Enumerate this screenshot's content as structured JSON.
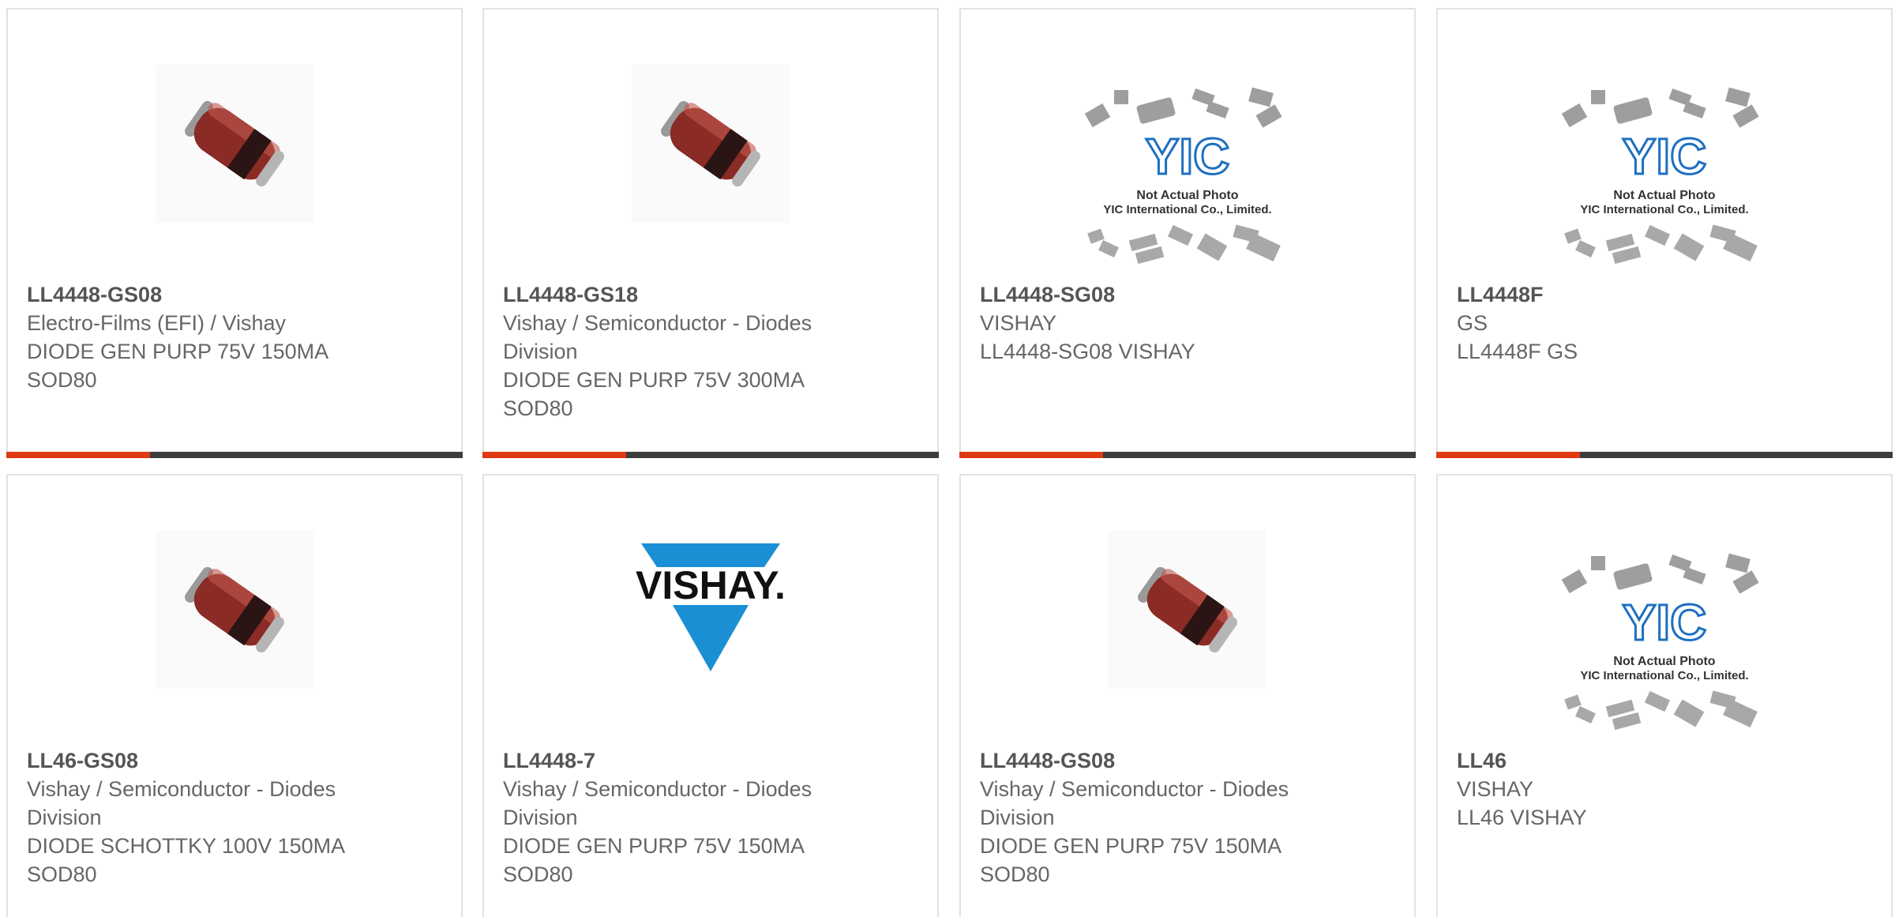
{
  "colors": {
    "accent": "#e03a14",
    "bar_dark": "#3d3d3d",
    "border": "#e2e2e2",
    "text": "#666666",
    "vishay_blue": "#1a8fd4"
  },
  "cards": [
    {
      "part": "LL4448-GS08",
      "image": "diode-photo",
      "lines": [
        "Electro-Films (EFI) / Vishay",
        "DIODE GEN PURP 75V 150MA",
        "SOD80",
        ""
      ]
    },
    {
      "part": "LL4448-GS18",
      "image": "diode-photo",
      "lines": [
        "Vishay / Semiconductor - Diodes",
        "Division",
        "DIODE GEN PURP 75V 300MA",
        "SOD80"
      ]
    },
    {
      "part": "LL4448-SG08",
      "image": "not-actual-photo",
      "lines": [
        "VISHAY",
        "LL4448-SG08 VISHAY",
        "",
        ""
      ]
    },
    {
      "part": "LL4448F",
      "image": "not-actual-photo",
      "lines": [
        "GS",
        "LL4448F GS",
        "",
        ""
      ]
    },
    {
      "part": "LL46-GS08",
      "image": "diode-photo",
      "lines": [
        "Vishay / Semiconductor - Diodes",
        "Division",
        "DIODE SCHOTTKY 100V 150MA",
        "SOD80"
      ]
    },
    {
      "part": "LL4448-7",
      "image": "vishay-logo",
      "lines": [
        "Vishay / Semiconductor - Diodes",
        "Division",
        "DIODE GEN PURP 75V 150MA",
        "SOD80"
      ]
    },
    {
      "part": "LL4448-GS08",
      "image": "diode-photo",
      "lines": [
        "Vishay / Semiconductor - Diodes",
        "Division",
        "DIODE GEN PURP 75V 150MA",
        "SOD80"
      ]
    },
    {
      "part": "LL46",
      "image": "not-actual-photo",
      "lines": [
        "VISHAY",
        "LL46 VISHAY",
        "",
        ""
      ]
    }
  ],
  "placeholder": {
    "brand": "YIC",
    "line1": "Not Actual Photo",
    "line2": "YIC International Co., Limited."
  },
  "logo_text": "VISHAY."
}
